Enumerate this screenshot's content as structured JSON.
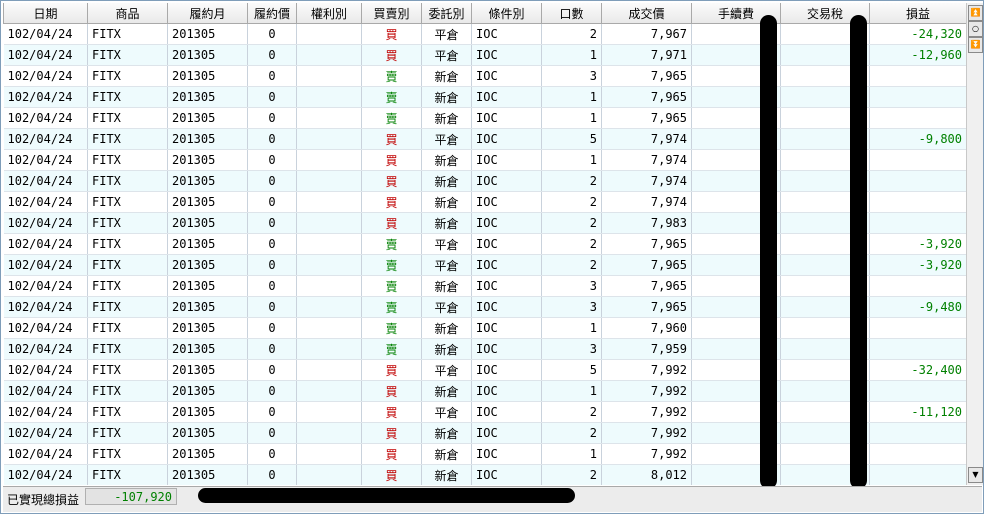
{
  "columns": [
    "日期",
    "商品",
    "履約月",
    "履約價",
    "權利別",
    "買賣別",
    "委託別",
    "條件別",
    "口數",
    "成交價",
    "手續費",
    "交易稅",
    "損益"
  ],
  "rows": [
    {
      "date": "102/04/24",
      "product": "FITX",
      "month": "201305",
      "strike": "0",
      "right": "",
      "side": "買",
      "order": "平倉",
      "cond": "IOC",
      "qty": "2",
      "price": "7,967",
      "fee": "",
      "tax": "",
      "pnl": "-24,320"
    },
    {
      "date": "102/04/24",
      "product": "FITX",
      "month": "201305",
      "strike": "0",
      "right": "",
      "side": "買",
      "order": "平倉",
      "cond": "IOC",
      "qty": "1",
      "price": "7,971",
      "fee": "",
      "tax": "",
      "pnl": "-12,960"
    },
    {
      "date": "102/04/24",
      "product": "FITX",
      "month": "201305",
      "strike": "0",
      "right": "",
      "side": "賣",
      "order": "新倉",
      "cond": "IOC",
      "qty": "3",
      "price": "7,965",
      "fee": "",
      "tax": "",
      "pnl": ""
    },
    {
      "date": "102/04/24",
      "product": "FITX",
      "month": "201305",
      "strike": "0",
      "right": "",
      "side": "賣",
      "order": "新倉",
      "cond": "IOC",
      "qty": "1",
      "price": "7,965",
      "fee": "",
      "tax": "",
      "pnl": ""
    },
    {
      "date": "102/04/24",
      "product": "FITX",
      "month": "201305",
      "strike": "0",
      "right": "",
      "side": "賣",
      "order": "新倉",
      "cond": "IOC",
      "qty": "1",
      "price": "7,965",
      "fee": "",
      "tax": "",
      "pnl": ""
    },
    {
      "date": "102/04/24",
      "product": "FITX",
      "month": "201305",
      "strike": "0",
      "right": "",
      "side": "買",
      "order": "平倉",
      "cond": "IOC",
      "qty": "5",
      "price": "7,974",
      "fee": "",
      "tax": "",
      "pnl": "-9,800"
    },
    {
      "date": "102/04/24",
      "product": "FITX",
      "month": "201305",
      "strike": "0",
      "right": "",
      "side": "買",
      "order": "新倉",
      "cond": "IOC",
      "qty": "1",
      "price": "7,974",
      "fee": "",
      "tax": "",
      "pnl": ""
    },
    {
      "date": "102/04/24",
      "product": "FITX",
      "month": "201305",
      "strike": "0",
      "right": "",
      "side": "買",
      "order": "新倉",
      "cond": "IOC",
      "qty": "2",
      "price": "7,974",
      "fee": "",
      "tax": "",
      "pnl": ""
    },
    {
      "date": "102/04/24",
      "product": "FITX",
      "month": "201305",
      "strike": "0",
      "right": "",
      "side": "買",
      "order": "新倉",
      "cond": "IOC",
      "qty": "2",
      "price": "7,974",
      "fee": "",
      "tax": "",
      "pnl": ""
    },
    {
      "date": "102/04/24",
      "product": "FITX",
      "month": "201305",
      "strike": "0",
      "right": "",
      "side": "買",
      "order": "新倉",
      "cond": "IOC",
      "qty": "2",
      "price": "7,983",
      "fee": "",
      "tax": "",
      "pnl": ""
    },
    {
      "date": "102/04/24",
      "product": "FITX",
      "month": "201305",
      "strike": "0",
      "right": "",
      "side": "賣",
      "order": "平倉",
      "cond": "IOC",
      "qty": "2",
      "price": "7,965",
      "fee": "",
      "tax": "",
      "pnl": "-3,920"
    },
    {
      "date": "102/04/24",
      "product": "FITX",
      "month": "201305",
      "strike": "0",
      "right": "",
      "side": "賣",
      "order": "平倉",
      "cond": "IOC",
      "qty": "2",
      "price": "7,965",
      "fee": "",
      "tax": "",
      "pnl": "-3,920"
    },
    {
      "date": "102/04/24",
      "product": "FITX",
      "month": "201305",
      "strike": "0",
      "right": "",
      "side": "賣",
      "order": "新倉",
      "cond": "IOC",
      "qty": "3",
      "price": "7,965",
      "fee": "",
      "tax": "",
      "pnl": ""
    },
    {
      "date": "102/04/24",
      "product": "FITX",
      "month": "201305",
      "strike": "0",
      "right": "",
      "side": "賣",
      "order": "平倉",
      "cond": "IOC",
      "qty": "3",
      "price": "7,965",
      "fee": "",
      "tax": "",
      "pnl": "-9,480"
    },
    {
      "date": "102/04/24",
      "product": "FITX",
      "month": "201305",
      "strike": "0",
      "right": "",
      "side": "賣",
      "order": "新倉",
      "cond": "IOC",
      "qty": "1",
      "price": "7,960",
      "fee": "",
      "tax": "",
      "pnl": ""
    },
    {
      "date": "102/04/24",
      "product": "FITX",
      "month": "201305",
      "strike": "0",
      "right": "",
      "side": "賣",
      "order": "新倉",
      "cond": "IOC",
      "qty": "3",
      "price": "7,959",
      "fee": "",
      "tax": "",
      "pnl": ""
    },
    {
      "date": "102/04/24",
      "product": "FITX",
      "month": "201305",
      "strike": "0",
      "right": "",
      "side": "買",
      "order": "平倉",
      "cond": "IOC",
      "qty": "5",
      "price": "7,992",
      "fee": "",
      "tax": "",
      "pnl": "-32,400"
    },
    {
      "date": "102/04/24",
      "product": "FITX",
      "month": "201305",
      "strike": "0",
      "right": "",
      "side": "買",
      "order": "新倉",
      "cond": "IOC",
      "qty": "1",
      "price": "7,992",
      "fee": "",
      "tax": "",
      "pnl": ""
    },
    {
      "date": "102/04/24",
      "product": "FITX",
      "month": "201305",
      "strike": "0",
      "right": "",
      "side": "買",
      "order": "平倉",
      "cond": "IOC",
      "qty": "2",
      "price": "7,992",
      "fee": "",
      "tax": "",
      "pnl": "-11,120"
    },
    {
      "date": "102/04/24",
      "product": "FITX",
      "month": "201305",
      "strike": "0",
      "right": "",
      "side": "買",
      "order": "新倉",
      "cond": "IOC",
      "qty": "2",
      "price": "7,992",
      "fee": "",
      "tax": "",
      "pnl": ""
    },
    {
      "date": "102/04/24",
      "product": "FITX",
      "month": "201305",
      "strike": "0",
      "right": "",
      "side": "買",
      "order": "新倉",
      "cond": "IOC",
      "qty": "1",
      "price": "7,992",
      "fee": "",
      "tax": "",
      "pnl": ""
    },
    {
      "date": "102/04/24",
      "product": "FITX",
      "month": "201305",
      "strike": "0",
      "right": "",
      "side": "買",
      "order": "新倉",
      "cond": "IOC",
      "qty": "2",
      "price": "8,012",
      "fee": "",
      "tax": "",
      "pnl": ""
    }
  ],
  "footer": {
    "total_label": "已實現總損益",
    "total_value": "-107,920"
  },
  "scrollbar": {
    "up_icon": "double-up-arrow-icon",
    "mid_icon": "circle-icon",
    "down_icon": "double-down-arrow-icon",
    "bottom_icon": "down-arrow-icon"
  },
  "colors": {
    "buy": "#c00000",
    "sell": "#008000",
    "pnl": "#008000",
    "row_alt": "#eefbfd"
  }
}
